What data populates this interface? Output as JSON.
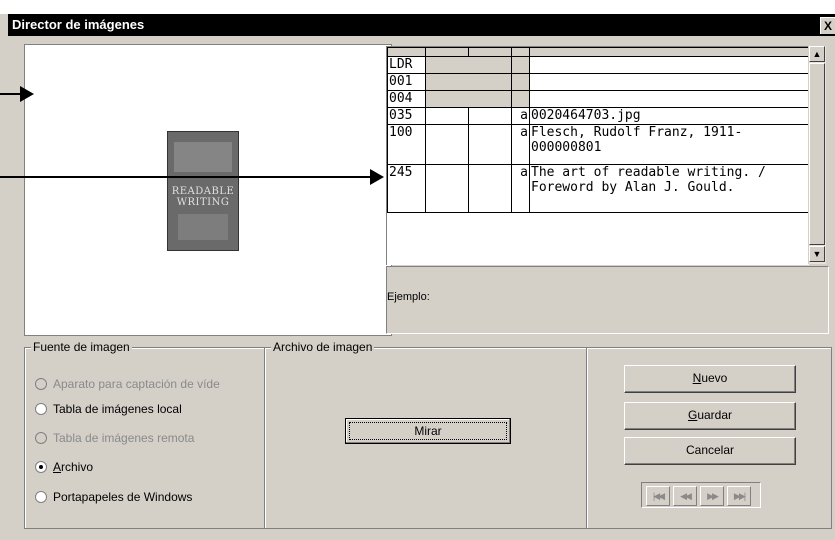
{
  "window": {
    "title": "Director de imágenes",
    "close_glyph": "X"
  },
  "preview": {
    "thumbnail_text": "READABLE WRITING"
  },
  "marc_grid": {
    "rows": [
      {
        "tag": "LDR",
        "sub": "",
        "value": ""
      },
      {
        "tag": "001",
        "sub": "",
        "value": ""
      },
      {
        "tag": "004",
        "sub": "",
        "value": ""
      },
      {
        "tag": "035",
        "sub": "a",
        "value": "0020464703.jpg"
      },
      {
        "tag": "100",
        "sub": "a",
        "value": "Flesch, Rudolf Franz, 1911-",
        "value2": "000000801"
      },
      {
        "tag": "245",
        "sub": "a",
        "value": "The art of readable writing. /",
        "value2": "Foreword by Alan J. Gould."
      }
    ]
  },
  "ejemplo": {
    "label": "Ejemplo:"
  },
  "fuente": {
    "legend": "Fuente de imagen",
    "options": [
      {
        "label": "Aparato para captación de víde",
        "disabled": true,
        "selected": false
      },
      {
        "label": "Tabla de imágenes local",
        "disabled": false,
        "selected": false
      },
      {
        "label": "Tabla de imágenes remota",
        "disabled": true,
        "selected": false
      },
      {
        "label": "Archivo",
        "disabled": false,
        "selected": true
      },
      {
        "label": "Portapapeles de Windows",
        "disabled": false,
        "selected": false
      }
    ]
  },
  "archivo": {
    "legend": "Archivo de imagen",
    "mirar_label": "Mirar"
  },
  "actions": {
    "nuevo": "Nuevo",
    "guardar": "Guardar",
    "cancelar": "Cancelar"
  },
  "nav": {
    "first": "|◀◀",
    "prev": "◀◀",
    "next": "▶▶",
    "last": "▶▶|"
  }
}
